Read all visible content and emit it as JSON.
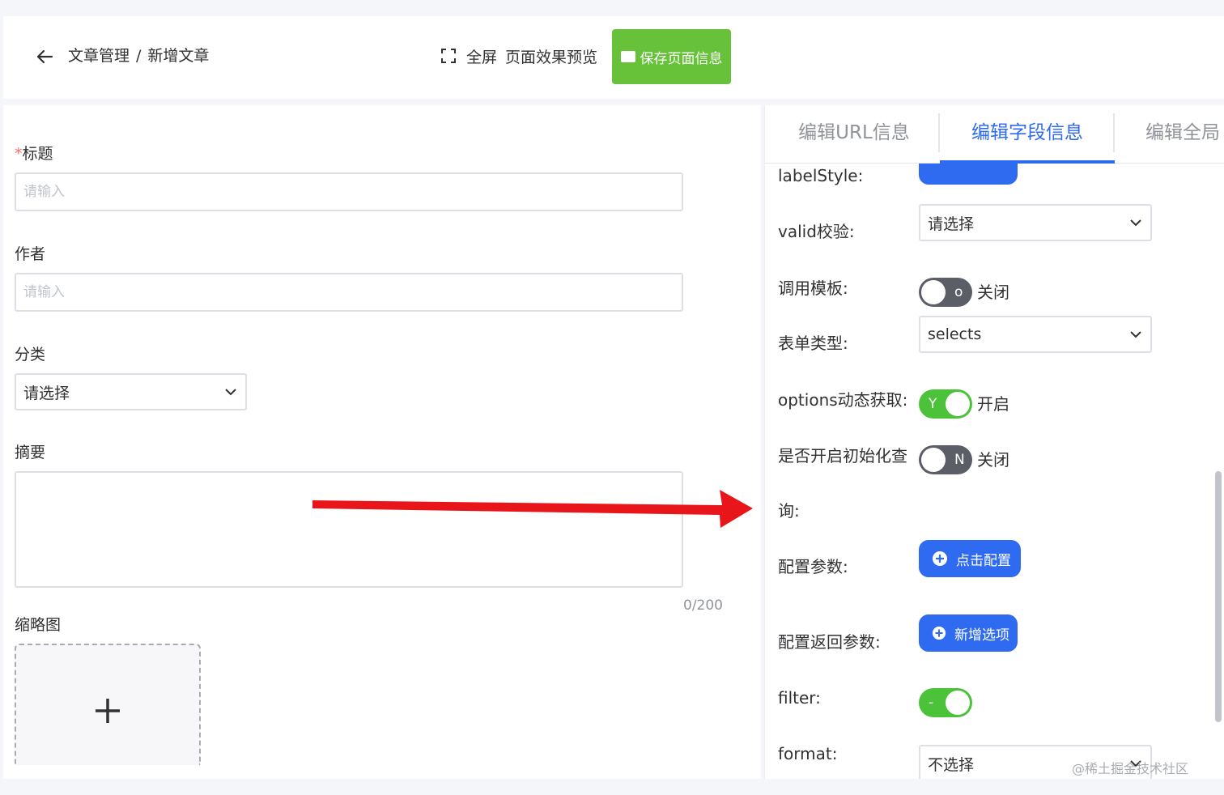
{
  "header": {
    "breadcrumb": [
      "文章管理",
      "新增文章"
    ],
    "breadcrumb_sep": "/",
    "fullscreen_label": "全屏",
    "preview_label": "页面效果预览",
    "save_label": "保存页面信息"
  },
  "form": {
    "title": {
      "required_mark": "*",
      "label": "标题",
      "placeholder": "请输入"
    },
    "author": {
      "label": "作者",
      "placeholder": "请输入"
    },
    "category": {
      "label": "分类",
      "selected": "请选择"
    },
    "summary": {
      "label": "摘要",
      "counter": "0/200"
    },
    "thumbnail": {
      "label": "缩略图"
    }
  },
  "panel": {
    "tabs": [
      {
        "label": "编辑URL信息",
        "active": false
      },
      {
        "label": "编辑字段信息",
        "active": true
      },
      {
        "label": "编辑全局",
        "active": false
      }
    ],
    "fields": {
      "label_style": {
        "label": "labelStyle:"
      },
      "valid": {
        "label": "valid校验:",
        "selected": "请选择"
      },
      "template": {
        "label": "调用模板:",
        "switch_text": "o",
        "state": "关闭",
        "on": false
      },
      "form_type": {
        "label": "表单类型:",
        "selected": "selects"
      },
      "options_dynamic": {
        "label": "options动态获取:",
        "switch_text": "Y",
        "state": "开启",
        "on": true
      },
      "init_query": {
        "label_line1": "是否开启初始化查",
        "label_line2": "询:",
        "switch_text": "N",
        "state": "关闭",
        "on": false
      },
      "config_params": {
        "label": "配置参数:",
        "button": "点击配置"
      },
      "config_return": {
        "label": "配置返回参数:",
        "button": "新增选项"
      },
      "filter": {
        "label": "filter:",
        "switch_text": "-",
        "on": true
      },
      "format": {
        "label": "format:",
        "selected": "不选择"
      }
    }
  },
  "watermark": "@稀土掘金技术社区",
  "colors": {
    "primary": "#2f6bf0",
    "success": "#67c23a",
    "switch_on": "#4cc23a",
    "switch_off": "#5b5e66",
    "required": "#f56c6c",
    "arrow": "#e8161b"
  }
}
